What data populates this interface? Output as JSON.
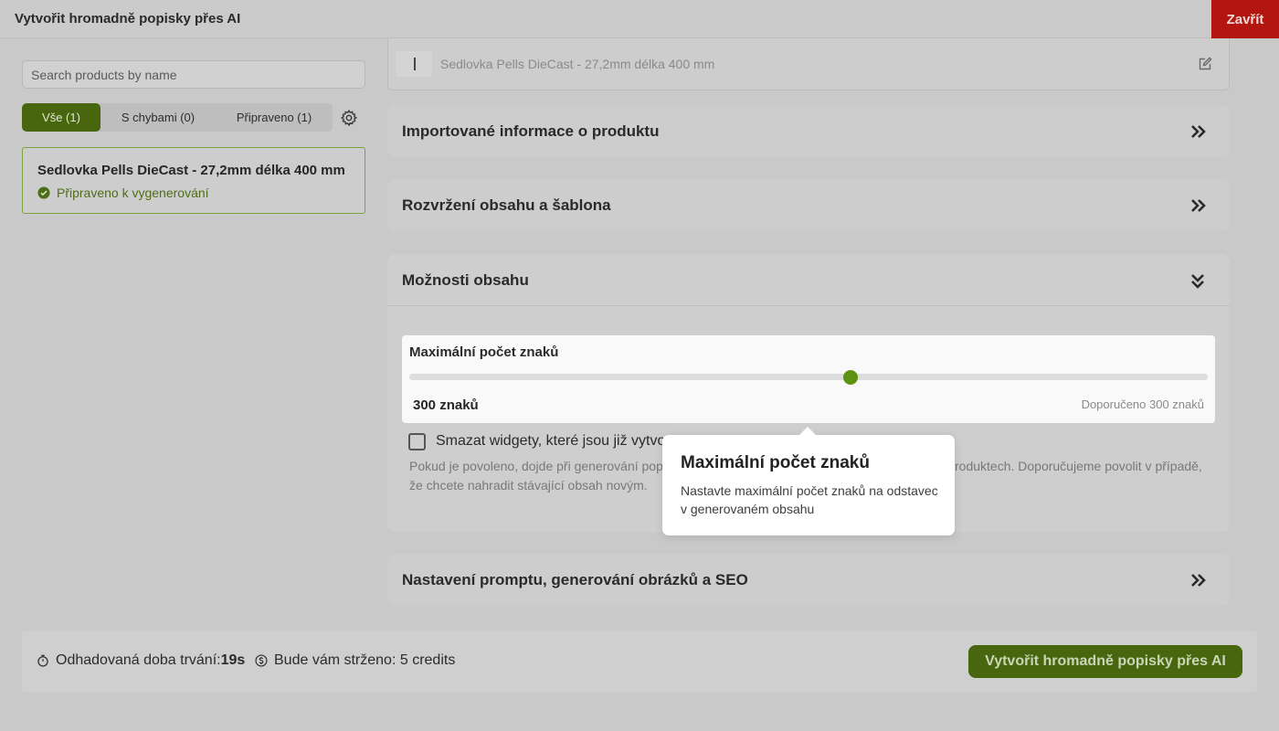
{
  "header": {
    "title": "Vytvořit hromadně popisky přes AI",
    "close_label": "Zavřít"
  },
  "sidebar": {
    "search_placeholder": "Search products by name",
    "tabs": [
      {
        "label": "Vše (1)",
        "active": true
      },
      {
        "label": "S chybami (0)",
        "active": false
      },
      {
        "label": "Připraveno (1)",
        "active": false
      }
    ],
    "products": [
      {
        "name": "Sedlovka Pells DieCast - 27,2mm délka 400 mm",
        "status": "Připraveno k vygenerování"
      }
    ]
  },
  "main": {
    "partial_product": {
      "name": "Sedlovka Pells DieCast - 27,2mm délka 400 mm"
    },
    "sections": [
      {
        "title": "Importované informace o produktu"
      },
      {
        "title": "Rozvržení obsahu a šablona"
      },
      {
        "title": "Možnosti obsahu"
      },
      {
        "title": "Nastavení promptu, generování obrázků a SEO"
      }
    ],
    "content_options": {
      "max_chars_label": "Maximální počet znaků",
      "max_chars_value": "300 znaků",
      "max_chars_recommended": "Doporučeno 300 znaků",
      "slider_fraction": 0.553,
      "delete_widgets_label": "Smazat widgety, které jsou již vytvořené",
      "delete_widgets_help_a": "Pokud je povoleno, dojde při generování popisků",
      "delete_widgets_help_b": "roduktech. Doporučujeme povolit v případě,",
      "delete_widgets_help_2": "že chcete nahradit stávající obsah novým."
    },
    "tooltip": {
      "title": "Maximální počet znaků",
      "body": "Nastavte maximální počet znaků na odstavec v generovaném obsahu"
    }
  },
  "footer": {
    "duration_label": "Odhadovaná doba trvání:",
    "duration_value": "19s",
    "credits_text": "Bude vám strženo: 5 credits",
    "submit_label": "Vytvořit hromadně popisky přes AI"
  },
  "colors": {
    "brand_green": "#47660e",
    "accent_green": "#5c9311",
    "close_red": "#b3150f"
  }
}
